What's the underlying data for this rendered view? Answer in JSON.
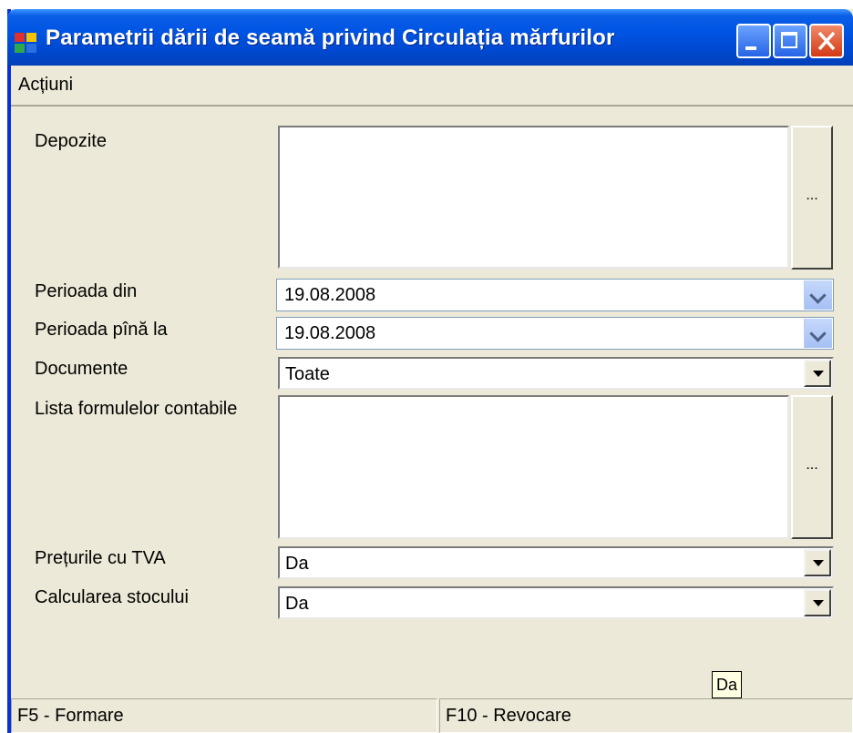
{
  "window": {
    "title": "Parametrii dării de seamă privind Circulația mărfurilor"
  },
  "menu": {
    "items": [
      "Acțiuni"
    ]
  },
  "form": {
    "depozite": {
      "label": "Depozite",
      "browse_label": "..."
    },
    "perioada_din": {
      "label": "Perioada din",
      "value": "19.08.2008"
    },
    "perioada_pina": {
      "label": "Perioada pînă la",
      "value": "19.08.2008"
    },
    "documente": {
      "label": "Documente",
      "value": "Toate"
    },
    "formule": {
      "label": "Lista formulelor contabile",
      "browse_label": "..."
    },
    "preturile": {
      "label": "Prețurile cu TVA",
      "value": "Da"
    },
    "calcularea": {
      "label": "Calcularea stocului",
      "value": "Da"
    }
  },
  "tooltip": {
    "text": "Da"
  },
  "statusbar": {
    "left": "F5 - Formare",
    "right": "F10 - Revocare"
  }
}
